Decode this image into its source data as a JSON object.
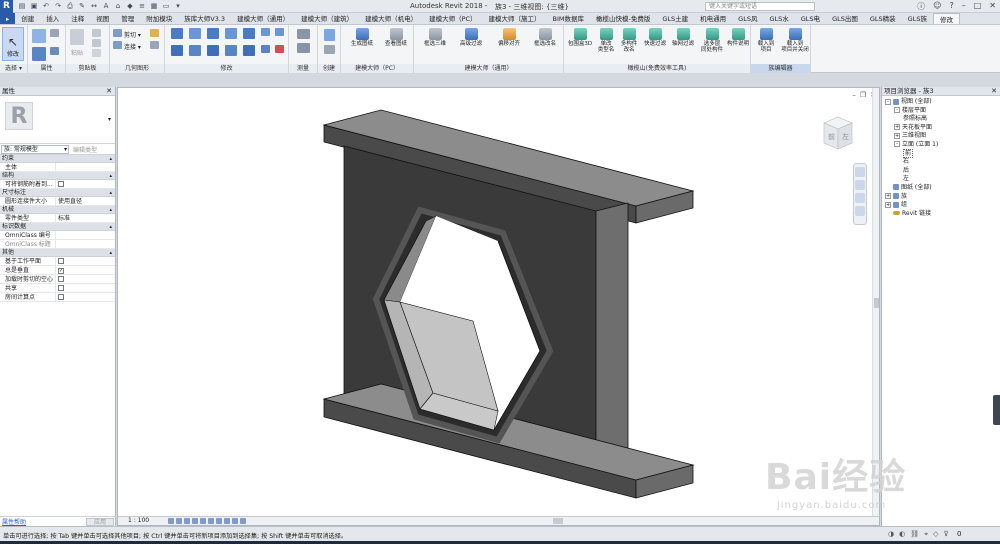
{
  "window": {
    "title": "Autodesk Revit 2018 -",
    "doc": "族3 - 三维视图: {三维}",
    "search_placeholder": "键入关键字或短语"
  },
  "tabs": [
    "创建",
    "插入",
    "注释",
    "视图",
    "管理",
    "附加模块",
    "族库大师V3.3",
    "建模大师（通用）",
    "建模大师（建筑）",
    "建模大师（机电）",
    "建模大师（PC）",
    "建模大师（施工）",
    "BIM数据库",
    "橄榄山快模-免费版",
    "GLS土建",
    "机电通用",
    "GLS风",
    "GLS水",
    "GLS电",
    "GLS出图",
    "GLS精装",
    "GLS族",
    "修改"
  ],
  "ribbon": {
    "modify": "修改",
    "select": "选择 ▾",
    "properties": "属性",
    "clipboard": "剪贴板",
    "geometry": "几何图形",
    "modify_panel": "修改",
    "measure": "测量",
    "create": "创建",
    "cut": "剪切 ▾",
    "join": "连接 ▾",
    "pc_label": "建模大师（PC）",
    "general_label": "建模大师（通用）",
    "gls_label": "橄榄山(免费效率工具)",
    "family_editor": "族编辑器",
    "btn_gen_drawing": "生成图纸",
    "btn_view_drawing": "查看图纸",
    "btn_filter3d": "框选三维",
    "btn_adv_filter": "高级过滤",
    "btn_align": "偏移对齐",
    "btn_rename": "框选改名",
    "btn_box3d": "包围盒3D",
    "btn_change_type": "单改\n类型名",
    "btn_multi_rename": "多构件\n改名",
    "btn_quick_filter": "快速过滤",
    "btn_axis_filter": "轴网过滤",
    "btn_multi_layer": "选多层\n同处构件",
    "btn_desc": "构件说明",
    "btn_load": "载入到\n项目",
    "btn_load_close": "载入到\n项目并关闭"
  },
  "properties": {
    "title": "属性",
    "family_type": "族: 常规模型",
    "edit_type": "编辑类型",
    "sections": [
      {
        "name": "约束",
        "rows": [
          {
            "k": "主体",
            "v": ""
          }
        ]
      },
      {
        "name": "结构",
        "rows": [
          {
            "k": "可将钢筋附着到...",
            "v": "",
            "cb": true,
            "checked": false
          }
        ]
      },
      {
        "name": "尺寸标注",
        "rows": [
          {
            "k": "圆形连接件大小",
            "v": "使用直径"
          }
        ]
      },
      {
        "name": "机械",
        "rows": [
          {
            "k": "零件类型",
            "v": "标准"
          }
        ]
      },
      {
        "name": "标识数据",
        "rows": [
          {
            "k": "OmniClass 编号",
            "v": ""
          },
          {
            "k": "OmniClass 标题",
            "v": "",
            "dim": true
          }
        ]
      },
      {
        "name": "其他",
        "rows": [
          {
            "k": "基于工作平面",
            "v": "",
            "cb": true,
            "checked": false
          },
          {
            "k": "总是垂直",
            "v": "",
            "cb": true,
            "checked": true
          },
          {
            "k": "加载时剪切的空心",
            "v": "",
            "cb": true,
            "checked": false
          },
          {
            "k": "共享",
            "v": "",
            "cb": true,
            "checked": false
          },
          {
            "k": "房间计算点",
            "v": "",
            "cb": true,
            "checked": false
          }
        ]
      }
    ],
    "help_link": "属性帮助",
    "apply": "应用"
  },
  "view": {
    "scale": "1 : 100",
    "cube_front": "前",
    "cube_right": "左"
  },
  "browser": {
    "title": "项目浏览器 - 族3",
    "tree": [
      {
        "label": "视图 (全部)",
        "level": 0,
        "tog": "-",
        "icon": true
      },
      {
        "label": "楼层平面",
        "level": 1,
        "tog": "-"
      },
      {
        "label": "参照标高",
        "level": 2,
        "tog": ""
      },
      {
        "label": "天花板平面",
        "level": 1,
        "tog": "+"
      },
      {
        "label": "三维视图",
        "level": 1,
        "tog": "+"
      },
      {
        "label": "立面 (立面 1)",
        "level": 1,
        "tog": "-"
      },
      {
        "label": "前",
        "level": 2,
        "tog": "",
        "selected": true
      },
      {
        "label": "右",
        "level": 2,
        "tog": ""
      },
      {
        "label": "后",
        "level": 2,
        "tog": ""
      },
      {
        "label": "左",
        "level": 2,
        "tog": ""
      },
      {
        "label": "图纸 (全部)",
        "level": 0,
        "tog": "",
        "icon": true
      },
      {
        "label": "族",
        "level": 0,
        "tog": "+",
        "icon": true
      },
      {
        "label": "组",
        "level": 0,
        "tog": "+",
        "icon": true
      },
      {
        "label": "Revit 链接",
        "level": 0,
        "tog": "",
        "link": true
      }
    ]
  },
  "status": {
    "text": "单击可进行选择; 按 Tab 键并单击可选择其他项目; 按 Ctrl 键并单击可将新项目添加到选择集; 按 Shift 键并单击可取消选择。",
    "count": "0"
  },
  "watermark": {
    "main": "Bai经验",
    "sub": "jingyan.baidu.com"
  },
  "colors": {
    "accent": "#2a5ba8",
    "model_dark": "#3d3d3d",
    "model_mid": "#6a6a6a",
    "model_light": "#9a9a9a"
  }
}
